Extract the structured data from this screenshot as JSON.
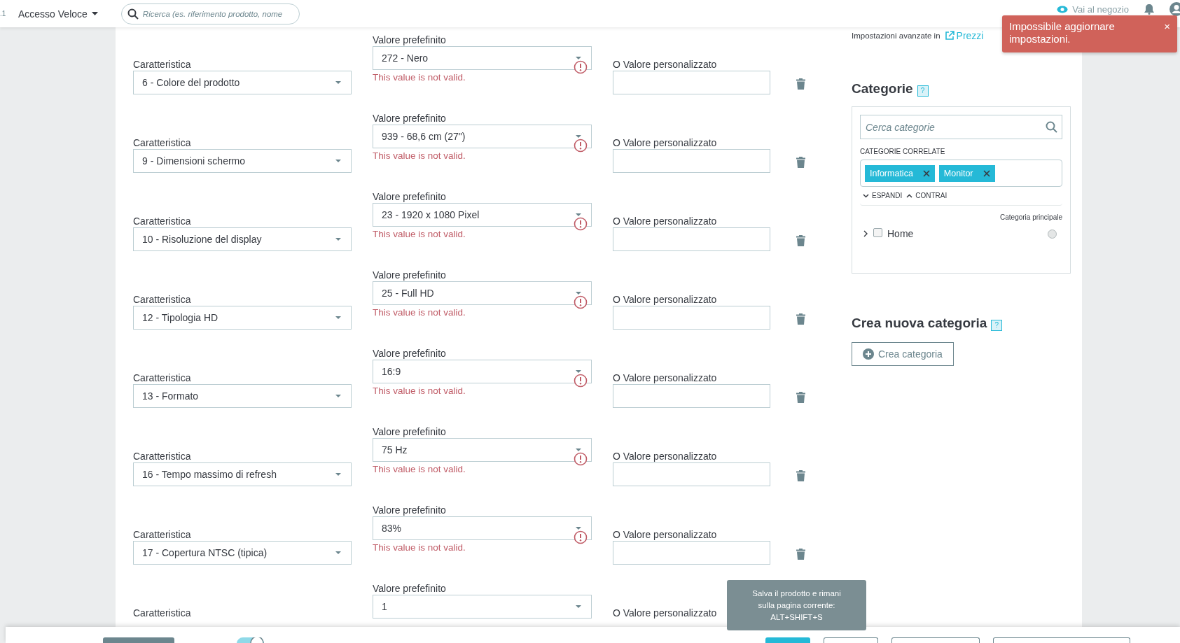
{
  "top_bar": {
    "version_fragment": ".1",
    "quick_access": "Accesso Veloce",
    "search": {
      "placeholder": "Ricerca (es. riferimento prodotto, nome"
    },
    "shop_link": "Vai al negozio"
  },
  "toast": {
    "message": "Impossibile aggiornare impostazioni.",
    "close": "×"
  },
  "features": [
    {
      "feature_label": "Caratteristica",
      "feature": "6 - Colore del prodotto",
      "value_label": "Valore prefefinito",
      "value": "272 - Nero",
      "error": "This value is not valid.",
      "custom_label": "O Valore personalizzato"
    },
    {
      "feature_label": "Caratteristica",
      "feature": "9 - Dimensioni schermo",
      "value_label": "Valore prefefinito",
      "value": "939 - 68,6 cm (27\")",
      "error": "This value is not valid.",
      "custom_label": "O Valore personalizzato"
    },
    {
      "feature_label": "Caratteristica",
      "feature": "10 - Risoluzione del display",
      "value_label": "Valore prefefinito",
      "value": "23 - 1920 x 1080 Pixel",
      "error": "This value is not valid.",
      "custom_label": "O Valore personalizzato"
    },
    {
      "feature_label": "Caratteristica",
      "feature": "12 - Tipologia HD",
      "value_label": "Valore prefefinito",
      "value": "25 - Full HD",
      "error": "This value is not valid.",
      "custom_label": "O Valore personalizzato"
    },
    {
      "feature_label": "Caratteristica",
      "feature": "13 - Formato",
      "value_label": "Valore prefefinito",
      "value": "16:9",
      "error": "This value is not valid.",
      "custom_label": "O Valore personalizzato"
    },
    {
      "feature_label": "Caratteristica",
      "feature": "16 - Tempo massimo di refresh",
      "value_label": "Valore prefefinito",
      "value": "75 Hz",
      "error": "This value is not valid.",
      "custom_label": "O Valore personalizzato"
    },
    {
      "feature_label": "Caratteristica",
      "feature": "17 - Copertura NTSC (tipica)",
      "value_label": "Valore prefefinito",
      "value": "83%",
      "error": "This value is not valid.",
      "custom_label": "O Valore personalizzato"
    },
    {
      "feature_label": "Caratteristica",
      "value_label": "Valore prefefinito",
      "value": "1",
      "custom_label": "O Valore personalizzato"
    }
  ],
  "advanced": {
    "text": "Impostazioni avanzate in",
    "link": "Prezzi"
  },
  "categories": {
    "title": "Categorie",
    "help": "?",
    "search_placeholder": "Cerca categorie",
    "related_label": "CATEGORIE CORRELATE",
    "tags": [
      "Informatica",
      "Monitor"
    ],
    "expand": "ESPANDI",
    "collapse": "CONTRAI",
    "main_label": "Categoria principale",
    "tree": [
      {
        "label": "Home",
        "expanded": false,
        "checked": false,
        "selected": false
      }
    ]
  },
  "new_category": {
    "title": "Crea nuova categoria",
    "help": "?",
    "button": "Crea categoria"
  },
  "tooltip": {
    "text": "Salva il prodotto e rimani\nsulla pagina corrente:\nALT+SHIFT+S"
  },
  "bottom_bar": {
    "controls": [
      {
        "kind": "dark"
      },
      {
        "kind": "toggle",
        "on": true
      },
      {
        "kind": "primary"
      },
      {
        "kind": "outline"
      },
      {
        "kind": "outline"
      },
      {
        "kind": "outline"
      }
    ]
  }
}
